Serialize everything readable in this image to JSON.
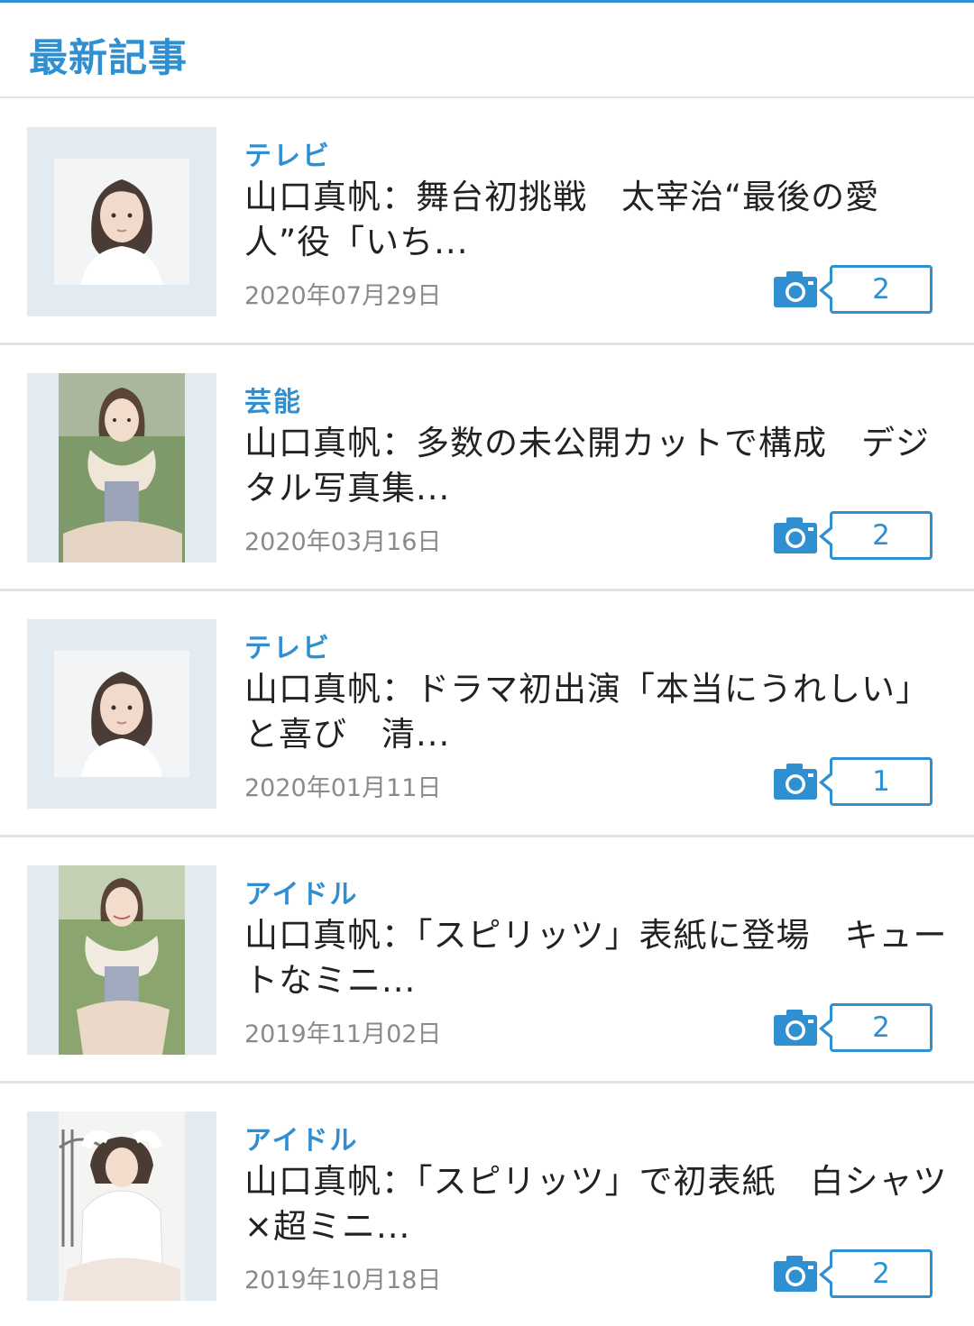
{
  "section": {
    "title": "最新記事"
  },
  "articles": [
    {
      "category": "テレビ",
      "title": "山口真帆：舞台初挑戦　太宰治“最後の愛人”役「いち...",
      "date": "2020年07月29日",
      "photo_count": "2",
      "thumb_icon": "portrait-photo"
    },
    {
      "category": "芸能",
      "title": "山口真帆：多数の未公開カットで構成　デジタル写真集...",
      "date": "2020年03月16日",
      "photo_count": "2",
      "thumb_icon": "outdoor-photo"
    },
    {
      "category": "テレビ",
      "title": "山口真帆：ドラマ初出演「本当にうれしい」と喜び　清...",
      "date": "2020年01月11日",
      "photo_count": "1",
      "thumb_icon": "portrait-photo"
    },
    {
      "category": "アイドル",
      "title": "山口真帆：「スピリッツ」表紙に登場　キュートなミニ...",
      "date": "2019年11月02日",
      "photo_count": "2",
      "thumb_icon": "outdoor-photo"
    },
    {
      "category": "アイドル",
      "title": "山口真帆：「スピリッツ」で初表紙　白シャツ×超ミニ...",
      "date": "2019年10月18日",
      "photo_count": "2",
      "thumb_icon": "bedroom-photo"
    }
  ],
  "colors": {
    "accent": "#2f8fd1",
    "date_text": "#8a8a8a",
    "divider": "#e3e3e3",
    "thumb_bg": "#e2eaf2"
  },
  "icons": {
    "camera": "camera-icon"
  }
}
